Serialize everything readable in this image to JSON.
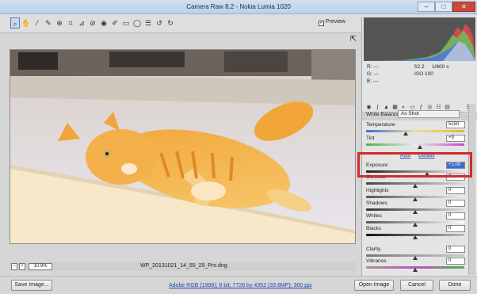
{
  "window": {
    "title": "Camera Raw 8.2  -  Nokia Lumia 1020"
  },
  "toolbar": {
    "tools": [
      "zoom-tool",
      "hand-tool",
      "white-balance-tool",
      "color-sampler-tool",
      "targeted-adjustment-tool",
      "crop-tool",
      "straighten-tool",
      "spot-removal-tool",
      "red-eye-removal-tool",
      "adjustment-brush-tool",
      "graduated-filter-tool",
      "radial-filter-tool",
      "preferences-icon",
      "rotate-left-icon",
      "rotate-right-icon"
    ],
    "preview_label": "Preview",
    "preview_checked": true
  },
  "status": {
    "zoom": "10.9%",
    "filename": "WP_20131021_14_55_29_Pro.dng"
  },
  "bottom": {
    "save_label": "Save Image...",
    "workflow_link": "Adobe RGB (1998); 8 bit; 7728 by 4352 (33.6MP); 300 ppi",
    "open_label": "Open Image",
    "cancel_label": "Cancel",
    "done_label": "Done"
  },
  "info": {
    "r_label": "R:",
    "g_label": "G:",
    "b_label": "B:",
    "r_value": "---",
    "g_value": "---",
    "b_value": "---",
    "aperture": "f/2.2",
    "shutter": "1/600 s",
    "iso": "ISO 100"
  },
  "panel": {
    "section_title": "Basic",
    "white_balance_label": "White Balance:",
    "white_balance_value": "As Shot",
    "auto_label": "Auto",
    "default_label": "Default",
    "sliders": [
      {
        "label": "Temperature",
        "value": "5150",
        "level": 0.4
      },
      {
        "label": "Tint",
        "value": "+9",
        "level": 0.55
      },
      {
        "label": "Exposure",
        "value": "+1.00",
        "level": 0.62
      },
      {
        "label": "Contrast",
        "value": "0",
        "level": 0.5
      },
      {
        "label": "Highlights",
        "value": "0",
        "level": 0.5
      },
      {
        "label": "Shadows",
        "value": "0",
        "level": 0.5
      },
      {
        "label": "Whites",
        "value": "0",
        "level": 0.5
      },
      {
        "label": "Blacks",
        "value": "0",
        "level": 0.5
      },
      {
        "label": "Clarity",
        "value": "0",
        "level": 0.5
      },
      {
        "label": "Vibrance",
        "value": "0",
        "level": 0.5
      }
    ]
  },
  "colors": {
    "highlight": "#d42a2a",
    "selection": "#3b6fd1",
    "link": "#1f47b8"
  }
}
